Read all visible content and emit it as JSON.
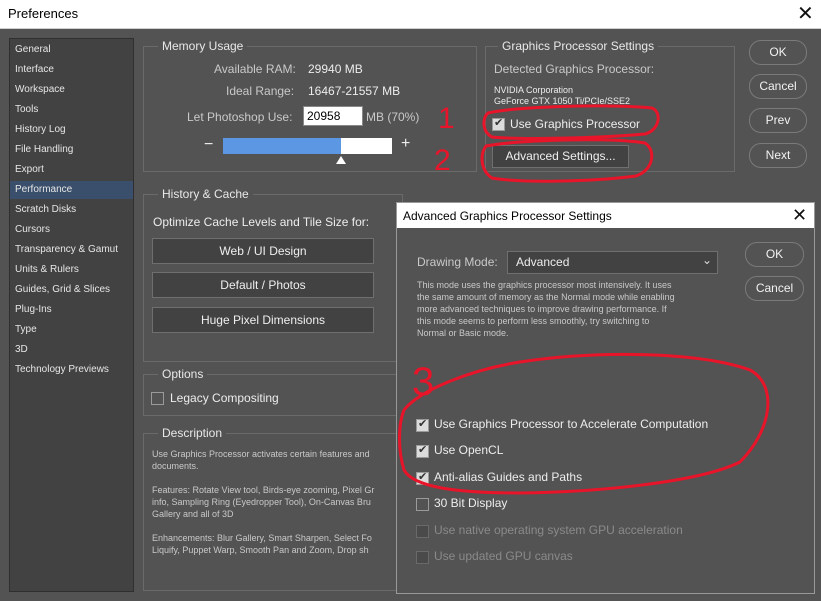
{
  "window": {
    "title": "Preferences",
    "close_glyph": "✕"
  },
  "sidebar": {
    "items": [
      "General",
      "Interface",
      "Workspace",
      "Tools",
      "History Log",
      "File Handling",
      "Export",
      "Performance",
      "Scratch Disks",
      "Cursors",
      "Transparency & Gamut",
      "Units & Rulers",
      "Guides, Grid & Slices",
      "Plug-Ins",
      "Type",
      "3D",
      "Technology Previews"
    ],
    "selected": "Performance"
  },
  "memory": {
    "legend": "Memory Usage",
    "available_label": "Available RAM:",
    "available_value": "29940 MB",
    "ideal_label": "Ideal Range:",
    "ideal_value": "16467-21557 MB",
    "let_use_label": "Let Photoshop Use:",
    "let_use_value": "20958",
    "let_use_unit": "MB (70%)",
    "minus": "−",
    "plus": "+",
    "slider_fraction": 0.7
  },
  "gpu": {
    "legend": "Graphics Processor Settings",
    "detected_label": "Detected Graphics Processor:",
    "vendor": "NVIDIA Corporation",
    "model": "GeForce GTX 1050 Ti/PCIe/SSE2",
    "use_gpu_label": "Use Graphics Processor",
    "advanced_button": "Advanced Settings..."
  },
  "history": {
    "legend": "History & Cache",
    "optimize_label": "Optimize Cache Levels and Tile Size for:",
    "buttons": [
      "Web / UI Design",
      "Default / Photos",
      "Huge Pixel Dimensions"
    ]
  },
  "options": {
    "legend": "Options",
    "legacy_label": "Legacy Compositing"
  },
  "description": {
    "legend": "Description",
    "p1": "Use Graphics Processor activates certain features and",
    "p1b": "documents.",
    "p2a": "Features: Rotate View tool, Birds-eye zooming, Pixel Gr",
    "p2b": "info, Sampling Ring (Eyedropper Tool), On-Canvas Bru",
    "p2c": "Gallery and all of 3D",
    "p3a": "Enhancements: Blur Gallery, Smart Sharpen, Select Fo",
    "p3b": "Liquify, Puppet Warp, Smooth Pan and Zoom, Drop sh"
  },
  "pref_buttons": {
    "ok": "OK",
    "cancel": "Cancel",
    "prev": "Prev",
    "next": "Next"
  },
  "advanced": {
    "title": "Advanced Graphics Processor Settings",
    "drawing_mode_label": "Drawing Mode:",
    "drawing_mode_value": "Advanced",
    "desc1": "This mode uses the graphics processor most intensively.  It uses",
    "desc2": "the same amount of memory as the Normal mode while enabling",
    "desc3": "more advanced techniques to improve drawing performance.  If",
    "desc4": "this mode seems to perform less smoothly, try switching to",
    "desc5": "Normal or Basic mode.",
    "checks": [
      {
        "label": "Use Graphics Processor to Accelerate Computation",
        "state": "checked"
      },
      {
        "label": "Use OpenCL",
        "state": "checked"
      },
      {
        "label": "Anti-alias Guides and Paths",
        "state": "checked"
      },
      {
        "label": "30 Bit Display",
        "state": "unchecked"
      },
      {
        "label": "Use native operating system GPU acceleration",
        "state": "disabled"
      },
      {
        "label": "Use updated GPU canvas",
        "state": "disabled"
      }
    ],
    "ok": "OK",
    "cancel": "Cancel"
  },
  "annotations": {
    "n1": "1",
    "n2": "2",
    "n3": "3",
    "color": "#e8142a"
  }
}
